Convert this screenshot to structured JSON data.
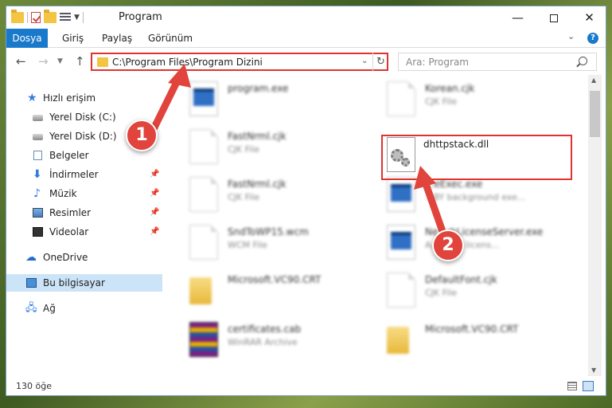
{
  "window": {
    "title": "Program",
    "minimize_glyph": "—",
    "close_glyph": "✕"
  },
  "ribbon": {
    "tabs": [
      {
        "label": "Dosya"
      },
      {
        "label": "Giriş"
      },
      {
        "label": "Paylaş"
      },
      {
        "label": "Görünüm"
      }
    ],
    "help_glyph": "?"
  },
  "navigation": {
    "address": "C:\\Program Files\\Program Dizini",
    "search_placeholder": "Ara: Program"
  },
  "sidebar": {
    "items": [
      {
        "label": "Hızlı erişim",
        "icon": "star-icon"
      },
      {
        "label": "Yerel Disk (C:)",
        "icon": "disk-icon"
      },
      {
        "label": "Yerel Disk (D:)",
        "icon": "disk-icon"
      },
      {
        "label": "Belgeler",
        "icon": "document-icon"
      },
      {
        "label": "İndirmeler",
        "icon": "download-icon"
      },
      {
        "label": "Müzik",
        "icon": "music-icon"
      },
      {
        "label": "Resimler",
        "icon": "pictures-icon"
      },
      {
        "label": "Videolar",
        "icon": "video-icon"
      },
      {
        "label": "OneDrive",
        "icon": "cloud-icon"
      },
      {
        "label": "Bu bilgisayar",
        "icon": "computer-icon"
      },
      {
        "label": "Ağ",
        "icon": "network-icon"
      }
    ]
  },
  "files": [
    {
      "name": "program.exe",
      "type": ""
    },
    {
      "name": "Korean.cjk",
      "type": "CJK File"
    },
    {
      "name": "FastNrml.cjk",
      "type": "CJK File"
    },
    {
      "name": "dhttpstack.dll",
      "type": ""
    },
    {
      "name": "FastNrml.cjk",
      "type": "CJK File"
    },
    {
      "name": "...eExec.exe",
      "type": "...BY background exe..."
    },
    {
      "name": "SndToWP15.wcm",
      "type": "WCM File"
    },
    {
      "name": "Ne...rkLicenseServer.exe",
      "type": "A... work licens..."
    },
    {
      "name": "Microsoft.VC90.CRT",
      "type": ""
    },
    {
      "name": "DefaultFont.cjk",
      "type": "CJK File"
    },
    {
      "name": "certificates.cab",
      "type": "WinRAR Archive"
    },
    {
      "name": "Microsoft.VC90.CRT",
      "type": ""
    }
  ],
  "status": {
    "item_count": "130 öğe"
  },
  "annotations": {
    "badge1": "1",
    "badge2": "2",
    "accent_color": "#e0443c"
  }
}
